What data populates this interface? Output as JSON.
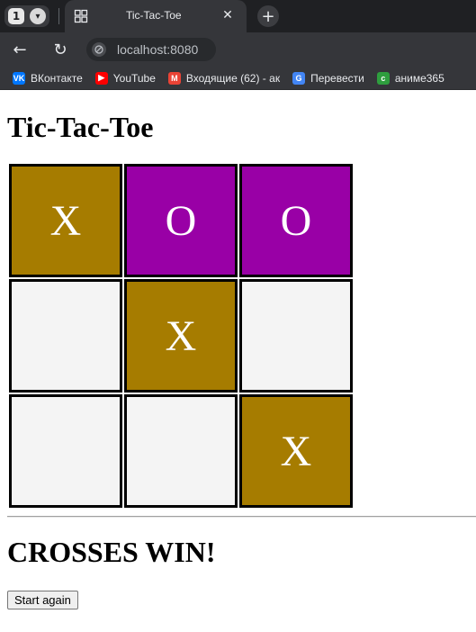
{
  "browser": {
    "tab_count": "1",
    "tab_title": "Tic-Tac-Toe",
    "url": "localhost:8080",
    "bookmarks": [
      {
        "label": "ВКонтакте",
        "icon": "vk-icon",
        "color": "#0077ff",
        "glyph": "VK"
      },
      {
        "label": "YouTube",
        "icon": "youtube-icon",
        "color": "#ff0000",
        "glyph": "▶"
      },
      {
        "label": "Входящие (62) - ак",
        "icon": "gmail-icon",
        "color": "#ea4335",
        "glyph": "M"
      },
      {
        "label": "Перевести",
        "icon": "translate-icon",
        "color": "#4285f4",
        "glyph": "G"
      },
      {
        "label": "аниме365",
        "icon": "anime365-icon",
        "color": "#2e9e3e",
        "glyph": "c"
      }
    ]
  },
  "game": {
    "title": "Tic-Tac-Toe",
    "board": [
      "X",
      "O",
      "O",
      "",
      "X",
      "",
      "",
      "",
      "X"
    ],
    "colors": {
      "X": "#a67c00",
      "O": "#9900a6",
      "empty": "#f4f4f4"
    },
    "status": "CROSSES WIN!",
    "restart_label": "Start again"
  }
}
